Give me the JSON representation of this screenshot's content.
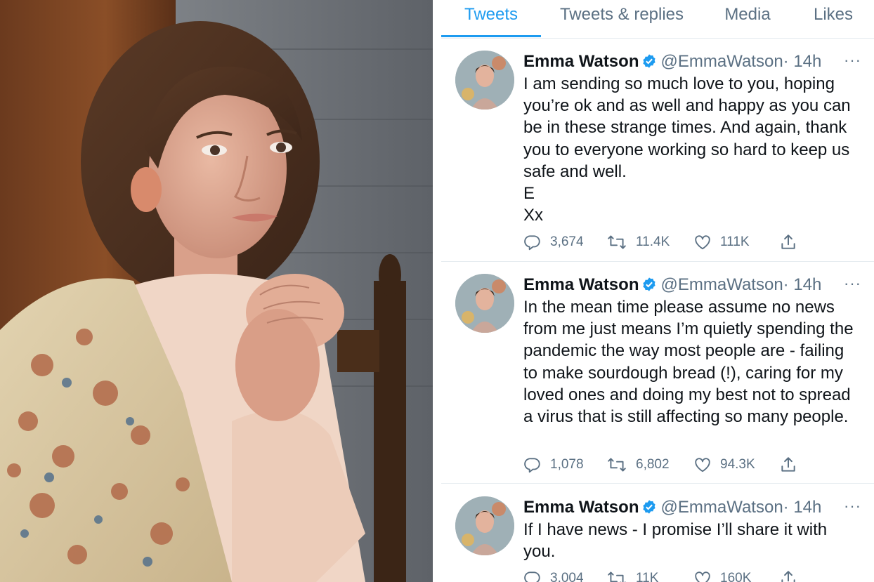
{
  "tabs": [
    {
      "label": "Tweets",
      "active": true
    },
    {
      "label": "Tweets & replies",
      "active": false
    },
    {
      "label": "Media",
      "active": false
    },
    {
      "label": "Likes",
      "active": false
    }
  ],
  "tweets": [
    {
      "name": "Emma Watson",
      "handle": "@EmmaWatson",
      "time": "· 14h",
      "text": "I am sending so much love to you, hoping you’re ok and as well and happy as you can be in these strange times. And again, thank you to everyone working so hard to keep us safe and well.\nE\nXx",
      "replies": "3,674",
      "retweets": "11.4K",
      "likes": "111K"
    },
    {
      "name": "Emma Watson",
      "handle": "@EmmaWatson",
      "time": "· 14h",
      "text": "In the mean time please assume no news from me just means I’m quietly spending the pandemic the way most people are - failing to make sourdough bread (!), caring for my loved ones and doing my best not to spread a virus that is still affecting so many people.",
      "replies": "1,078",
      "retweets": "6,802",
      "likes": "94.3K"
    },
    {
      "name": "Emma Watson",
      "handle": "@EmmaWatson",
      "time": "· 14h",
      "text": "If I have news - I promise I’ll share it with you.",
      "replies": "3,004",
      "retweets": "11K",
      "likes": "160K"
    }
  ],
  "more_glyph": "···",
  "colors": {
    "accent": "#1d9bf0",
    "secondary_text": "#5b7083",
    "primary_text": "#0f1419",
    "border": "#e6ecf0"
  },
  "icons": [
    "verified-badge-icon",
    "reply-icon",
    "retweet-icon",
    "like-icon",
    "share-icon",
    "more-icon"
  ]
}
